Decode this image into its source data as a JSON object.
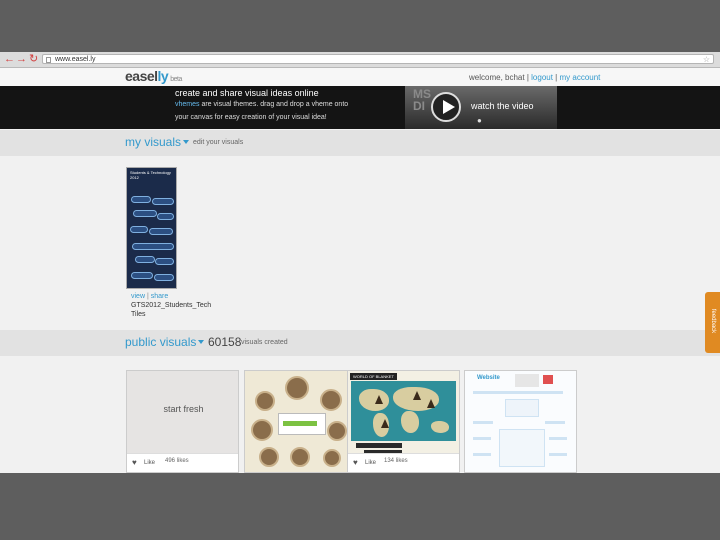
{
  "browser": {
    "url": "www.easel.ly"
  },
  "header": {
    "logo_main": "easel",
    "logo_accent": "ly",
    "logo_beta": "beta",
    "welcome": "welcome, bchat",
    "logout": "logout",
    "my_account": "my account",
    "separator": "|"
  },
  "banner": {
    "title": "create and share visual ideas online",
    "vhemes_word": "vhemes",
    "line2": " are visual themes. drag and drop a vheme onto",
    "line3": "your canvas for easy creation of your visual idea!",
    "video_label": "watch the video",
    "video_ghost": "MS\nDI",
    "video_brand_icon": "apple-icon"
  },
  "my_visuals": {
    "title": "my visuals",
    "edit_label": "edit your visuals",
    "item": {
      "thumb_title": "Students & Technology\n2012",
      "view": "view",
      "share": "share",
      "sep": "|",
      "name": "GTS2012_Students_Tech",
      "sub": "Tiles"
    }
  },
  "public_visuals": {
    "title": "public visuals",
    "count": "60158",
    "count_label": "visuals created",
    "start_fresh": "start fresh",
    "like_label": "Like",
    "cards": [
      {
        "likes": "496 likes"
      },
      {
        "likes": ""
      },
      {
        "likes": "134 likes",
        "header": "WORLD OF BLANKET"
      },
      {
        "likes": "",
        "title": "Website"
      }
    ]
  },
  "feedback_tab": {
    "label": "feedback"
  },
  "colors": {
    "accent": "#3399cc",
    "banner_bg": "#141414",
    "feedback": "#e08a22"
  }
}
